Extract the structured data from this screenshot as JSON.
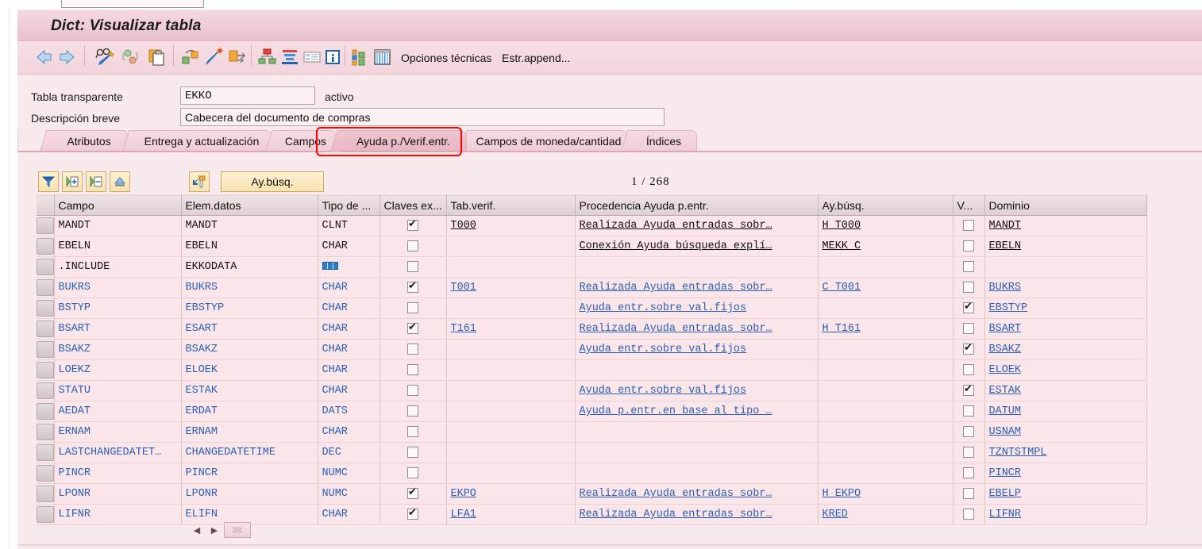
{
  "window": {
    "title": "Dict: Visualizar tabla"
  },
  "toolbar": {
    "icons": [
      {
        "name": "back-arrow-icon"
      },
      {
        "name": "forward-arrow-icon"
      },
      {
        "name": "display-change-icon"
      },
      {
        "name": "refresh-icon"
      },
      {
        "name": "copy-paste-icon"
      },
      {
        "name": "hierarchy-icon"
      },
      {
        "name": "magic-wand-icon"
      },
      {
        "name": "expand-arrows-icon"
      },
      {
        "name": "structure-icon"
      },
      {
        "name": "stack-icon"
      },
      {
        "name": "list-icon"
      },
      {
        "name": "info-icon"
      },
      {
        "name": "technical-settings-icon"
      },
      {
        "name": "table-grid-icon"
      }
    ],
    "technical_options_label": "Opciones técnicas",
    "append_structure_label": "Estr.append..."
  },
  "form": {
    "table_label": "Tabla transparente",
    "table_value": "EKKO",
    "status_label": "activo",
    "description_label": "Descripción breve",
    "description_value": "Cabecera del documento de compras"
  },
  "tabs": [
    {
      "label": "Atributos",
      "active": false
    },
    {
      "label": "Entrega y actualización",
      "active": false
    },
    {
      "label": "Campos",
      "active": false
    },
    {
      "label": "Ayuda p./Verif.entr.",
      "active": true
    },
    {
      "label": "Campos de moneda/cantidad",
      "active": false
    },
    {
      "label": "Índices",
      "active": false
    }
  ],
  "grid_toolbar": {
    "buttons": [
      {
        "name": "filter-icon"
      },
      {
        "name": "insert-row-icon"
      },
      {
        "name": "delete-row-icon"
      },
      {
        "name": "sort-up-icon"
      },
      {
        "name": "search-help-nav-icon"
      }
    ],
    "search_help_label": "Ay.búsq.",
    "page_counter": "1 / 268"
  },
  "table": {
    "columns": [
      "Campo",
      "Elem.datos",
      "Tipo de ...",
      "Claves ex...",
      "Tab.verif.",
      "Procedencia Ayuda p.entr.",
      "Ay.búsq.",
      "V...",
      "Dominio"
    ],
    "rows": [
      {
        "campo": "MANDT",
        "elem_datos": "MANDT",
        "tipo": "CLNT",
        "tipo_icon": false,
        "claves_ext": true,
        "tab_verif": "T000",
        "procedencia": "Realizada Ayuda entradas sobr…",
        "ay_busq": "H_T000",
        "v": false,
        "dominio": "MANDT",
        "style": "black"
      },
      {
        "campo": "EBELN",
        "elem_datos": "EBELN",
        "tipo": "CHAR",
        "tipo_icon": false,
        "claves_ext": false,
        "tab_verif": "",
        "procedencia": "Conexión Ayuda búsqueda explí…",
        "ay_busq": "MEKK_C",
        "v": false,
        "dominio": "EBELN",
        "style": "black"
      },
      {
        "campo": ".INCLUDE",
        "elem_datos": "EKKODATA",
        "tipo": "",
        "tipo_icon": true,
        "claves_ext": false,
        "tab_verif": "",
        "procedencia": "",
        "ay_busq": "",
        "v": false,
        "dominio": "",
        "style": "black"
      },
      {
        "campo": "BUKRS",
        "elem_datos": "BUKRS",
        "tipo": "CHAR",
        "tipo_icon": false,
        "claves_ext": true,
        "tab_verif": "T001",
        "procedencia": "Realizada Ayuda entradas sobr…",
        "ay_busq": "C_T001",
        "v": false,
        "dominio": "BUKRS",
        "style": "blue"
      },
      {
        "campo": "BSTYP",
        "elem_datos": "EBSTYP",
        "tipo": "CHAR",
        "tipo_icon": false,
        "claves_ext": false,
        "tab_verif": "",
        "procedencia": "Ayuda entr.sobre val.fijos",
        "ay_busq": "",
        "v": true,
        "dominio": "EBSTYP",
        "style": "blue"
      },
      {
        "campo": "BSART",
        "elem_datos": "ESART",
        "tipo": "CHAR",
        "tipo_icon": false,
        "claves_ext": true,
        "tab_verif": "T161",
        "procedencia": "Realizada Ayuda entradas sobr…",
        "ay_busq": "H_T161",
        "v": false,
        "dominio": "BSART",
        "style": "blue"
      },
      {
        "campo": "BSAKZ",
        "elem_datos": "BSAKZ",
        "tipo": "CHAR",
        "tipo_icon": false,
        "claves_ext": false,
        "tab_verif": "",
        "procedencia": "Ayuda entr.sobre val.fijos",
        "ay_busq": "",
        "v": true,
        "dominio": "BSAKZ",
        "style": "blue"
      },
      {
        "campo": "LOEKZ",
        "elem_datos": "ELOEK",
        "tipo": "CHAR",
        "tipo_icon": false,
        "claves_ext": false,
        "tab_verif": "",
        "procedencia": "",
        "ay_busq": "",
        "v": false,
        "dominio": "ELOEK",
        "style": "blue"
      },
      {
        "campo": "STATU",
        "elem_datos": "ESTAK",
        "tipo": "CHAR",
        "tipo_icon": false,
        "claves_ext": false,
        "tab_verif": "",
        "procedencia": "Ayuda entr.sobre val.fijos",
        "ay_busq": "",
        "v": true,
        "dominio": "ESTAK",
        "style": "blue"
      },
      {
        "campo": "AEDAT",
        "elem_datos": "ERDAT",
        "tipo": "DATS",
        "tipo_icon": false,
        "claves_ext": false,
        "tab_verif": "",
        "procedencia": "Ayuda p.entr.en base al tipo …",
        "ay_busq": "",
        "v": false,
        "dominio": "DATUM",
        "style": "blue"
      },
      {
        "campo": "ERNAM",
        "elem_datos": "ERNAM",
        "tipo": "CHAR",
        "tipo_icon": false,
        "claves_ext": false,
        "tab_verif": "",
        "procedencia": "",
        "ay_busq": "",
        "v": false,
        "dominio": "USNAM",
        "style": "blue"
      },
      {
        "campo": "LASTCHANGEDATET…",
        "elem_datos": "CHANGEDATETIME",
        "tipo": "DEC",
        "tipo_icon": false,
        "claves_ext": false,
        "tab_verif": "",
        "procedencia": "",
        "ay_busq": "",
        "v": false,
        "dominio": "TZNTSTMPL",
        "style": "blue"
      },
      {
        "campo": "PINCR",
        "elem_datos": "PINCR",
        "tipo": "NUMC",
        "tipo_icon": false,
        "claves_ext": false,
        "tab_verif": "",
        "procedencia": "",
        "ay_busq": "",
        "v": false,
        "dominio": "PINCR",
        "style": "blue"
      },
      {
        "campo": "LPONR",
        "elem_datos": "LPONR",
        "tipo": "NUMC",
        "tipo_icon": false,
        "claves_ext": true,
        "tab_verif": "EKPO",
        "procedencia": "Realizada Ayuda entradas sobr…",
        "ay_busq": "H_EKPO",
        "v": false,
        "dominio": "EBELP",
        "style": "blue"
      },
      {
        "campo": "LIFNR",
        "elem_datos": "ELIFN",
        "tipo": "CHAR",
        "tipo_icon": false,
        "claves_ext": true,
        "tab_verif": "LFA1",
        "procedencia": "Realizada Ayuda entradas sobr…",
        "ay_busq": "KRED",
        "v": false,
        "dominio": "LIFNR",
        "style": "blue"
      }
    ]
  },
  "scroll": {
    "left_arrow": "◀",
    "right_arrow": "▶"
  },
  "colors": {
    "accent_pink": "#f7e9ec",
    "title_pink": "#eeccd5",
    "row_pink": "#fae5e9",
    "link_blue": "#2b5fb5",
    "highlight_red": "#ff0000",
    "button_yellow": "#f8e2ae"
  }
}
